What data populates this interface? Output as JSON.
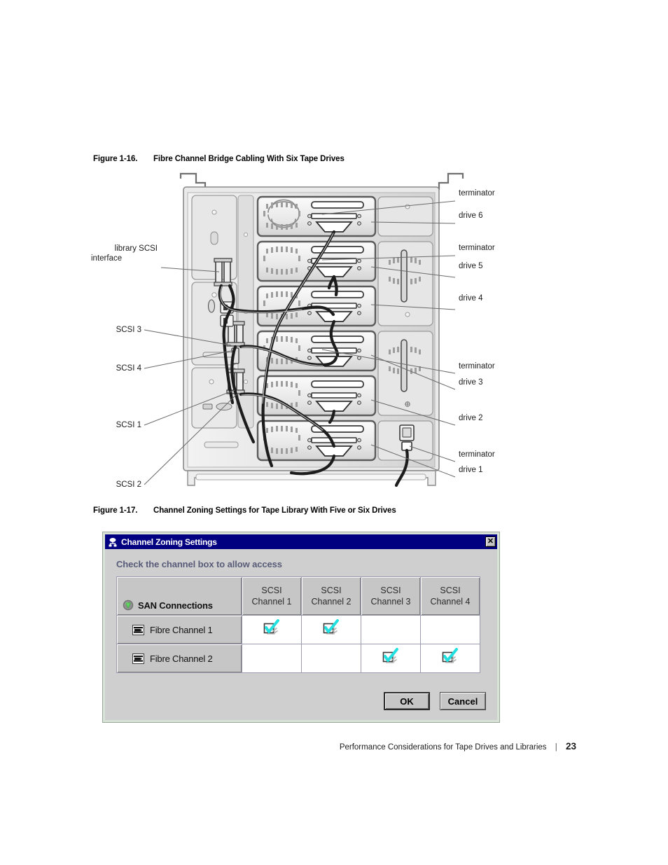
{
  "page": {
    "number": "23",
    "footer_title": "Performance Considerations for Tape Drives and Libraries",
    "footer_separator": "|"
  },
  "figure_1_16": {
    "number": "Figure 1-16.",
    "title": "Fibre Channel Bridge Cabling With Six Tape Drives",
    "left_callouts": [
      {
        "id": "library-scsi-interface",
        "line1": "library SCSI",
        "line2": "interface"
      },
      {
        "id": "scsi-3",
        "line1": "SCSI 3",
        "line2": ""
      },
      {
        "id": "scsi-4",
        "line1": "SCSI 4",
        "line2": ""
      },
      {
        "id": "scsi-1",
        "line1": "SCSI 1",
        "line2": ""
      },
      {
        "id": "scsi-2",
        "line1": "SCSI 2",
        "line2": ""
      }
    ],
    "right_callouts": [
      {
        "id": "terminator-6",
        "label": "terminator"
      },
      {
        "id": "drive-6",
        "label": "drive 6"
      },
      {
        "id": "terminator-5",
        "label": "terminator"
      },
      {
        "id": "drive-5",
        "label": "drive 5"
      },
      {
        "id": "drive-4",
        "label": "drive 4"
      },
      {
        "id": "terminator-3",
        "label": "terminator"
      },
      {
        "id": "drive-3",
        "label": "drive 3"
      },
      {
        "id": "drive-2",
        "label": "drive 2"
      },
      {
        "id": "terminator-1",
        "label": "terminator"
      },
      {
        "id": "drive-1",
        "label": "drive 1"
      }
    ]
  },
  "figure_1_17": {
    "number": "Figure 1-17.",
    "title": "Channel Zoning Settings for Tape Library With Five or Six Drives"
  },
  "dialog": {
    "title": "Channel Zoning Settings",
    "title_icon": "network-tree-icon",
    "close_label": "✕",
    "hint": "Check the channel box to allow access",
    "corner_header": "SAN Connections",
    "corner_icon": "globe-icon",
    "column_headers": [
      {
        "line1": "SCSI",
        "line2": "Channel 1"
      },
      {
        "line1": "SCSI",
        "line2": "Channel 2"
      },
      {
        "line1": "SCSI",
        "line2": "Channel 3"
      },
      {
        "line1": "SCSI",
        "line2": "Channel 4"
      }
    ],
    "rows": [
      {
        "label": "Fibre Channel 1",
        "icon": "fibre-channel-icon",
        "checks": [
          true,
          true,
          false,
          false
        ]
      },
      {
        "label": "Fibre Channel 2",
        "icon": "fibre-channel-icon",
        "checks": [
          false,
          false,
          true,
          true
        ]
      }
    ],
    "buttons": {
      "ok": "OK",
      "cancel": "Cancel"
    },
    "colors": {
      "titlebar": "#000080",
      "body": "#cfcfcf",
      "frame": "#d9e2d6",
      "hint_text": "#585c78",
      "check_mark": "#22e0e0",
      "globe_arrow": "#3cb83c"
    }
  }
}
